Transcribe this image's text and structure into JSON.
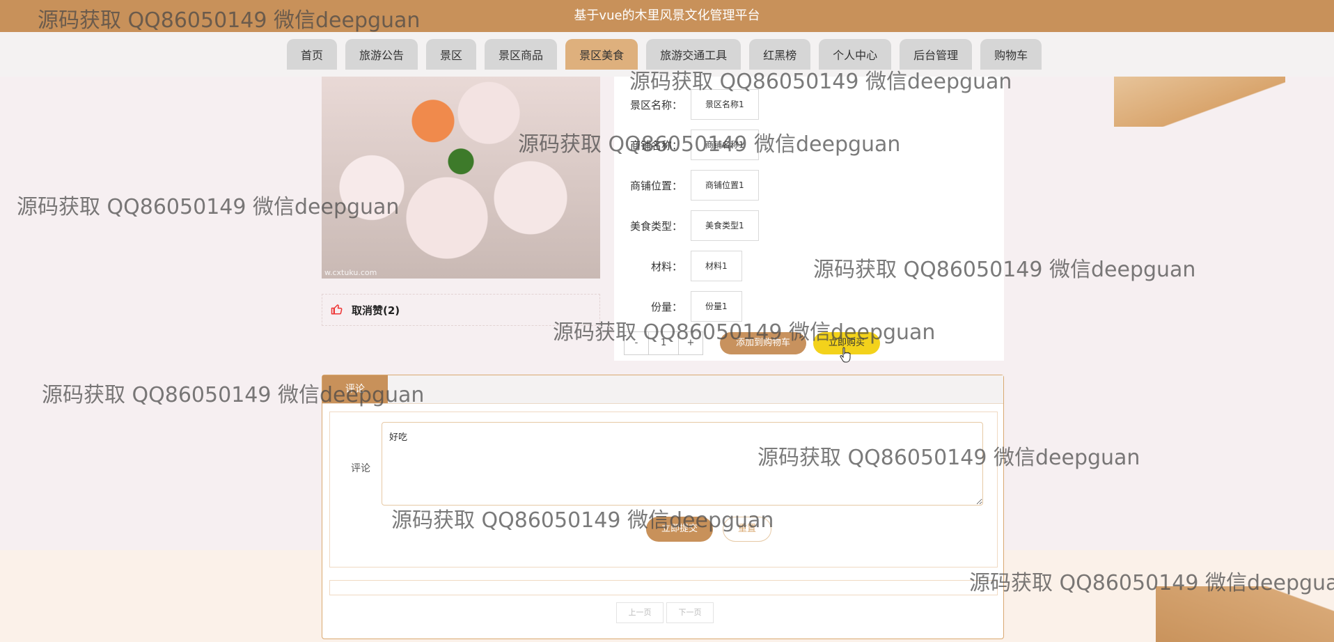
{
  "header": {
    "title": "基于vue的木里风景文化管理平台"
  },
  "nav": {
    "items": [
      {
        "label": "首页"
      },
      {
        "label": "旅游公告"
      },
      {
        "label": "景区"
      },
      {
        "label": "景区商品"
      },
      {
        "label": "景区美食",
        "active": true
      },
      {
        "label": "旅游交通工具"
      },
      {
        "label": "红黑榜"
      },
      {
        "label": "个人中心"
      },
      {
        "label": "后台管理"
      },
      {
        "label": "购物车"
      }
    ]
  },
  "product": {
    "image_caption": "w.cxtuku.com",
    "like_label": "取消赞(2)",
    "fields": [
      {
        "label": "景区名称：",
        "value": "景区名称1"
      },
      {
        "label": "商铺名称：",
        "value": "商铺名称1"
      },
      {
        "label": "商铺位置：",
        "value": "商铺位置1"
      },
      {
        "label": "美食类型：",
        "value": "美食类型1"
      },
      {
        "label": "材料：",
        "value": "材料1"
      },
      {
        "label": "份量：",
        "value": "份量1"
      }
    ],
    "quantity": {
      "minus": "-",
      "value": "1",
      "plus": "+"
    },
    "add_to_cart": "添加到购物车",
    "buy_now": "立即购买"
  },
  "comments": {
    "tab_label": "评论",
    "field_label": "评论",
    "textarea_value": "好吃",
    "submit_label": "立即提交",
    "reset_label": "重置",
    "pager": {
      "prev": "上一页",
      "next": "下一页"
    }
  },
  "watermark_text": "源码获取 QQ86050149 微信deepguan",
  "colors": {
    "header": "#c8915a",
    "accent_yellow": "#f3d21b",
    "nav_inactive": "#d6d6d6",
    "nav_active": "#deb07d"
  }
}
